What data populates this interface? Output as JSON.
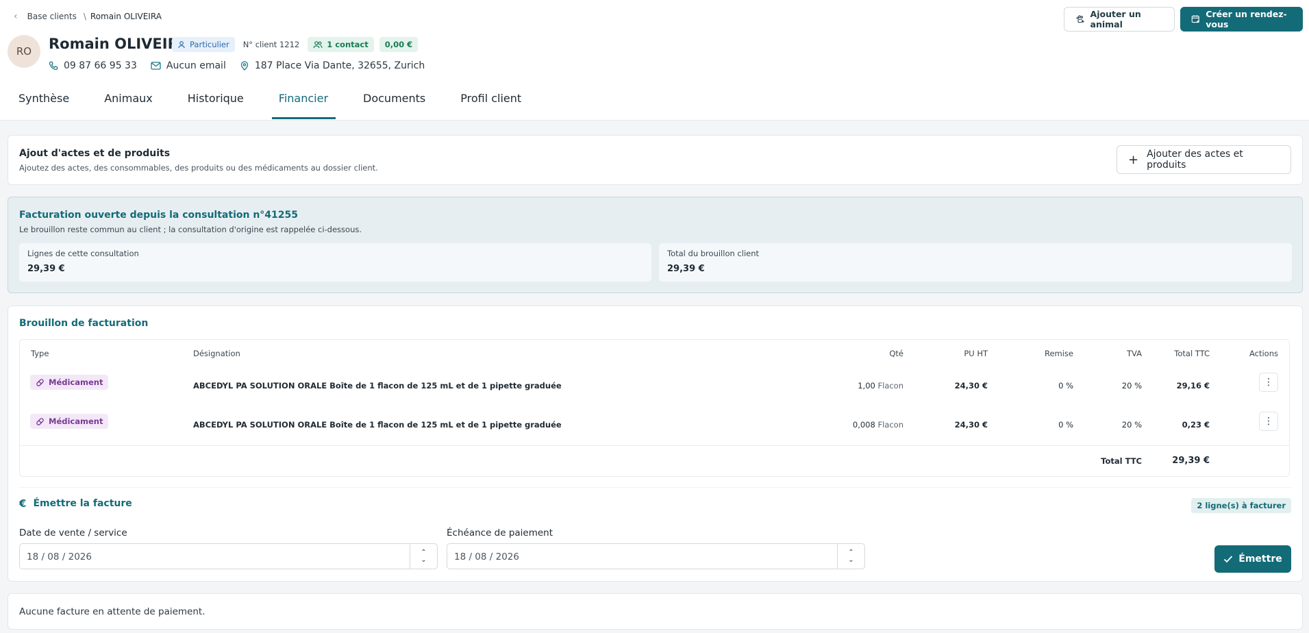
{
  "breadcrumb": {
    "parent": "Base clients",
    "separator": "\\",
    "current": "Romain OLIVEIRA"
  },
  "client": {
    "initials": "RO",
    "name": "Romain OLIVEIRA",
    "type_tag": "Particulier",
    "client_number": "N° client 1212",
    "contacts_tag": "1 contact",
    "balance_tag": "0,00 €",
    "phone": "09 87 66 95 33",
    "email": "Aucun email",
    "address": "187 Place Via Dante, 32655, Zurich"
  },
  "header_actions": {
    "add_animal": "Ajouter un animal",
    "create_appointment": "Créer un rendez-vous"
  },
  "tabs": [
    {
      "label": "Synthèse"
    },
    {
      "label": "Animaux"
    },
    {
      "label": "Historique"
    },
    {
      "label": "Financier"
    },
    {
      "label": "Documents"
    },
    {
      "label": "Profil client"
    }
  ],
  "active_tab": "Financier",
  "add_section": {
    "title": "Ajout d'actes et de produits",
    "subtitle": "Ajoutez des actes, des consommables, des produits ou des médicaments au dossier client.",
    "button": "Ajouter des actes et produits"
  },
  "billing_info": {
    "title": "Facturation ouverte depuis la consultation n°41255",
    "subtitle": "Le brouillon reste commun au client ; la consultation d'origine est rappelée ci-dessous.",
    "consultation_lines_label": "Lignes de cette consultation",
    "consultation_lines_value": "29,39 €",
    "draft_total_label": "Total du brouillon client",
    "draft_total_value": "29,39 €"
  },
  "draft": {
    "title": "Brouillon de facturation",
    "columns": {
      "type": "Type",
      "designation": "Désignation",
      "qty": "Qté",
      "pu_ht": "PU HT",
      "discount": "Remise",
      "vat": "TVA",
      "total_ttc": "Total TTC",
      "actions": "Actions"
    },
    "rows": [
      {
        "type": "Médicament",
        "designation": "ABCEDYL PA SOLUTION ORALE Boîte de 1 flacon de 125 mL et de 1 pipette graduée",
        "qty": "1,00",
        "unit": "Flacon",
        "pu_ht": "24,30 €",
        "discount": "0 %",
        "vat": "20 %",
        "total_ttc": "29,16 €",
        "menu": "⋮"
      },
      {
        "type": "Médicament",
        "designation": "ABCEDYL PA SOLUTION ORALE Boîte de 1 flacon de 125 mL et de 1 pipette graduée",
        "qty": "0,008",
        "unit": "Flacon",
        "pu_ht": "24,30 €",
        "discount": "0 %",
        "vat": "20 %",
        "total_ttc": "0,23 €",
        "menu": "⋮"
      }
    ],
    "total_label": "Total TTC",
    "total_value": "29,39 €"
  },
  "emit": {
    "title": "Émettre la facture",
    "currency_symbol": "€",
    "lines_badge": "2 ligne(s) à facturer",
    "sale_date_label": "Date de vente / service",
    "sale_date_value": "18 / 08 / 2026",
    "due_date_label": "Échéance de paiement",
    "due_date_value": "18 / 08 / 2026",
    "button": "Émettre"
  },
  "pending": {
    "message": "Aucune facture en attente de paiement."
  },
  "colors": {
    "primary": "#136b78",
    "med_badge_bg": "#f3e8f8",
    "med_badge_text": "#7a3a92"
  }
}
